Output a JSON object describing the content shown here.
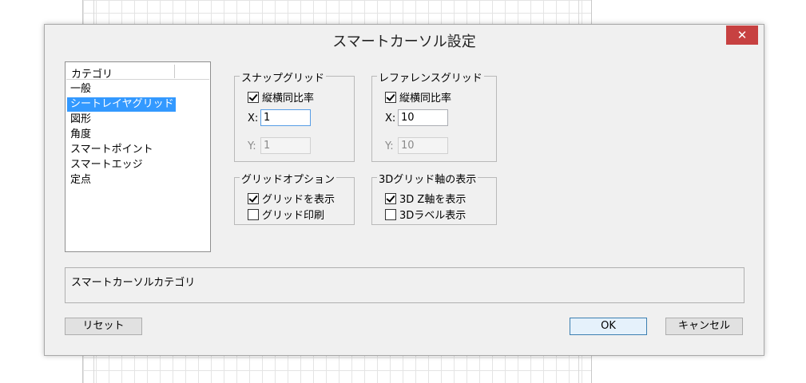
{
  "dialog": {
    "title": "スマートカーソル設定",
    "close_label": "✕"
  },
  "category_list": {
    "header": "カテゴリ",
    "items": [
      {
        "label": "一般",
        "selected": false
      },
      {
        "label": "シートレイヤグリッド",
        "selected": true
      },
      {
        "label": "図形",
        "selected": false
      },
      {
        "label": "角度",
        "selected": false
      },
      {
        "label": "スマートポイント",
        "selected": false
      },
      {
        "label": "スマートエッジ",
        "selected": false
      },
      {
        "label": "定点",
        "selected": false
      }
    ]
  },
  "snap_grid": {
    "title": "スナップグリッド",
    "aspect_label": "縦横同比率",
    "aspect_checked": true,
    "x_label": "X:",
    "x_value": "1",
    "y_label": "Y:",
    "y_value": "1"
  },
  "reference_grid": {
    "title": "レファレンスグリッド",
    "aspect_label": "縦横同比率",
    "aspect_checked": true,
    "x_label": "X:",
    "x_value": "10",
    "y_label": "Y:",
    "y_value": "10"
  },
  "grid_options": {
    "title": "グリッドオプション",
    "show_grid_label": "グリッドを表示",
    "show_grid_checked": true,
    "print_grid_label": "グリッド印刷",
    "print_grid_checked": false
  },
  "grid_3d": {
    "title": "3Dグリッド軸の表示",
    "z_axis_label": "3D Z軸を表示",
    "z_axis_checked": true,
    "label_3d_label": "3Dラベル表示",
    "label_3d_checked": false
  },
  "description": {
    "text": "スマートカーソルカテゴリ"
  },
  "buttons": {
    "reset": "リセット",
    "ok": "OK",
    "cancel": "キャンセル"
  }
}
